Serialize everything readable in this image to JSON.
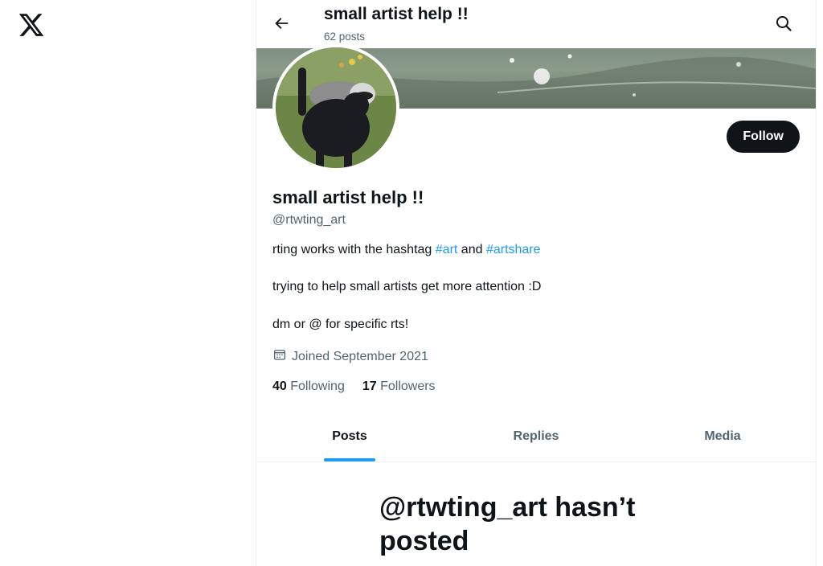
{
  "header": {
    "title": "small artist help !!",
    "post_count": "62 posts"
  },
  "profile": {
    "display_name": "small artist help !!",
    "handle": "@rtwting_art",
    "follow_label": "Follow",
    "bio": {
      "line1_pre": "rting works with the hashtag ",
      "line1_tag1": "#art",
      "line1_mid": " and ",
      "line1_tag2": "#artshare",
      "line2": "trying to help small artists get more attention :D",
      "line3": "dm or @ for specific rts!"
    },
    "joined": "Joined September 2021",
    "following_count": "40",
    "following_label": "Following",
    "followers_count": "17",
    "followers_label": "Followers"
  },
  "tabs": [
    {
      "label": "Posts",
      "active": true
    },
    {
      "label": "Replies",
      "active": false
    },
    {
      "label": "Media",
      "active": false
    }
  ],
  "empty_state": {
    "title": "@rtwting_art hasn’t posted"
  },
  "colors": {
    "accent": "#1d9bf0",
    "text": "#0f1419",
    "muted": "#536471",
    "button": "#0f1419"
  },
  "icons": [
    "x-logo-icon",
    "back-arrow-icon",
    "search-icon",
    "calendar-icon"
  ]
}
